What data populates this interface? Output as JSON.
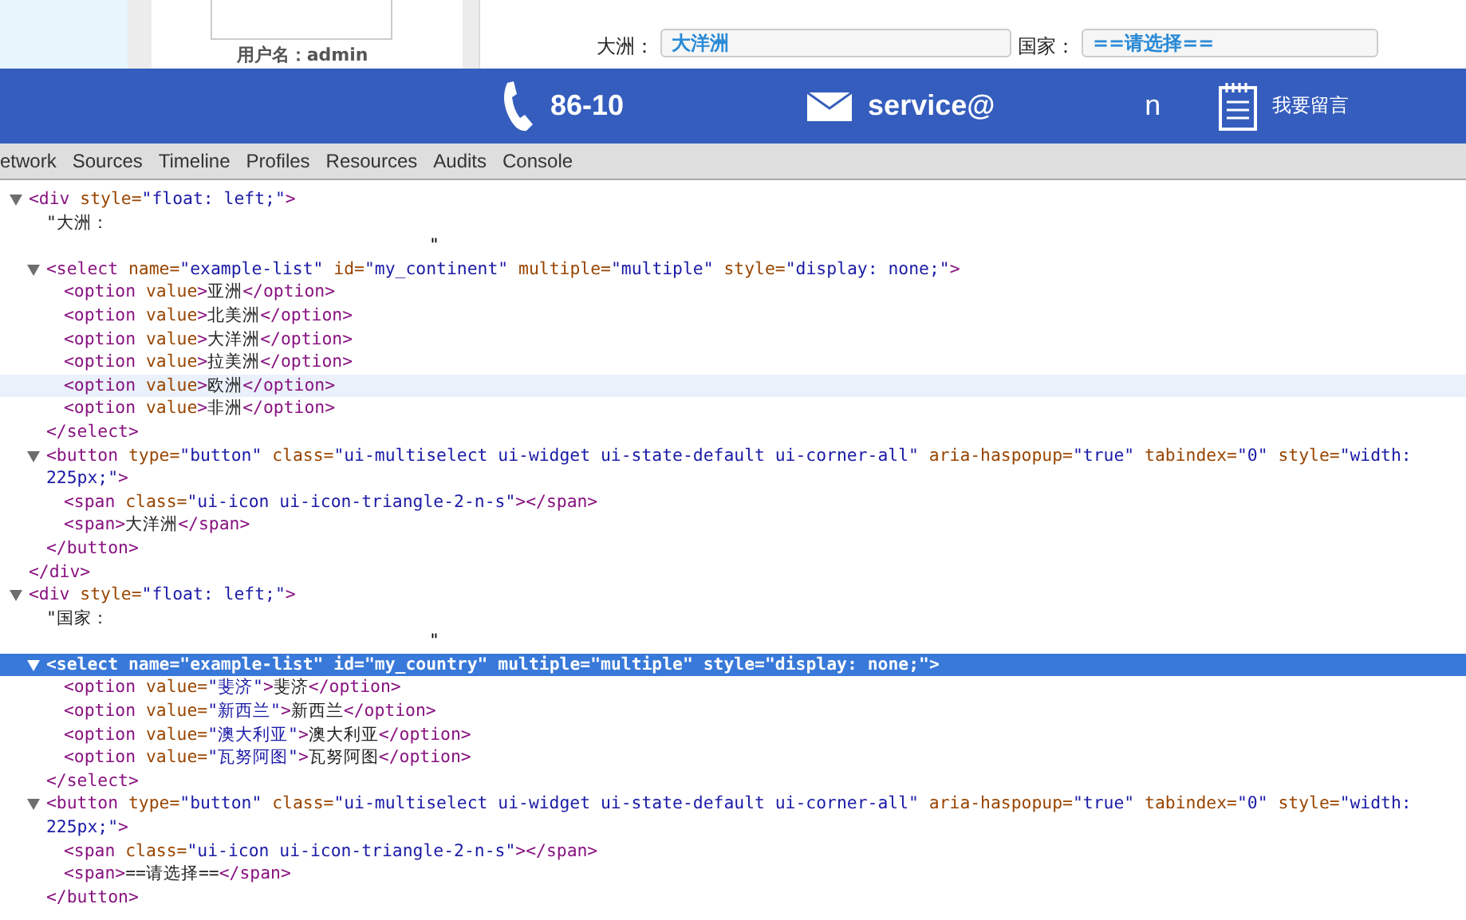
{
  "page": {
    "username": "用户名：admin",
    "continent_label": "大洲：",
    "continent_value": "大洋洲",
    "country_label": "国家：",
    "country_value": "==请选择=="
  },
  "banner": {
    "phone": "86-10",
    "email": "service@",
    "fragment": "n",
    "message": "我要留言"
  },
  "devtools_tabs": [
    {
      "label": "etwork",
      "selected": false
    },
    {
      "label": "Sources",
      "selected": false
    },
    {
      "label": "Timeline",
      "selected": false
    },
    {
      "label": "Profiles",
      "selected": false
    },
    {
      "label": "Resources",
      "selected": false
    },
    {
      "label": "Audits",
      "selected": false
    },
    {
      "label": "Console",
      "selected": false
    }
  ],
  "code": [
    {
      "kind": "element",
      "expanded": true,
      "selected": false,
      "hovered": false,
      "open": [
        {
          "kind": "tag",
          "text": "<div"
        },
        {
          "kind": "attr",
          "text": " style="
        },
        {
          "kind": "value",
          "text": "\"float: left;\""
        },
        {
          "kind": "tag",
          "text": ">"
        }
      ],
      "close": [
        {
          "kind": "tag",
          "text": "</div>"
        }
      ],
      "children": [
        {
          "kind": "text",
          "selected": false,
          "hovered": false,
          "text": "\"大洲：",
          "tail": "\""
        },
        {
          "kind": "element",
          "expanded": true,
          "selected": false,
          "hovered": false,
          "open": [
            {
              "kind": "tag",
              "text": "<select"
            },
            {
              "kind": "attr",
              "text": " name="
            },
            {
              "kind": "value",
              "text": "\"example-list\""
            },
            {
              "kind": "attr",
              "text": " id="
            },
            {
              "kind": "value",
              "text": "\"my_continent\""
            },
            {
              "kind": "attr",
              "text": " multiple="
            },
            {
              "kind": "value",
              "text": "\"multiple\""
            },
            {
              "kind": "attr",
              "text": " style="
            },
            {
              "kind": "value",
              "text": "\"display: none;\""
            },
            {
              "kind": "tag",
              "text": ">"
            }
          ],
          "close": [
            {
              "kind": "tag",
              "text": "</select>"
            }
          ],
          "children": [
            {
              "kind": "element",
              "selected": false,
              "hovered": false,
              "open": [
                {
                  "kind": "tag",
                  "text": "<option"
                },
                {
                  "kind": "attr",
                  "text": " value"
                },
                {
                  "kind": "tag",
                  "text": ">"
                },
                {
                  "kind": "text",
                  "text": "亚洲"
                },
                {
                  "kind": "tag",
                  "text": "</option>"
                }
              ]
            },
            {
              "kind": "element",
              "selected": false,
              "hovered": false,
              "open": [
                {
                  "kind": "tag",
                  "text": "<option"
                },
                {
                  "kind": "attr",
                  "text": " value"
                },
                {
                  "kind": "tag",
                  "text": ">"
                },
                {
                  "kind": "text",
                  "text": "北美洲"
                },
                {
                  "kind": "tag",
                  "text": "</option>"
                }
              ]
            },
            {
              "kind": "element",
              "selected": false,
              "hovered": false,
              "open": [
                {
                  "kind": "tag",
                  "text": "<option"
                },
                {
                  "kind": "attr",
                  "text": " value"
                },
                {
                  "kind": "tag",
                  "text": ">"
                },
                {
                  "kind": "text",
                  "text": "大洋洲"
                },
                {
                  "kind": "tag",
                  "text": "</option>"
                }
              ]
            },
            {
              "kind": "element",
              "selected": false,
              "hovered": false,
              "open": [
                {
                  "kind": "tag",
                  "text": "<option"
                },
                {
                  "kind": "attr",
                  "text": " value"
                },
                {
                  "kind": "tag",
                  "text": ">"
                },
                {
                  "kind": "text",
                  "text": "拉美洲"
                },
                {
                  "kind": "tag",
                  "text": "</option>"
                }
              ]
            },
            {
              "kind": "element",
              "selected": false,
              "hovered": true,
              "open": [
                {
                  "kind": "tag",
                  "text": "<option"
                },
                {
                  "kind": "attr",
                  "text": " value"
                },
                {
                  "kind": "tag",
                  "text": ">"
                },
                {
                  "kind": "text",
                  "text": "欧洲"
                },
                {
                  "kind": "tag",
                  "text": "</option>"
                }
              ]
            },
            {
              "kind": "element",
              "selected": false,
              "hovered": false,
              "open": [
                {
                  "kind": "tag",
                  "text": "<option"
                },
                {
                  "kind": "attr",
                  "text": " value"
                },
                {
                  "kind": "tag",
                  "text": ">"
                },
                {
                  "kind": "text",
                  "text": "非洲"
                },
                {
                  "kind": "tag",
                  "text": "</option>"
                }
              ]
            }
          ]
        },
        {
          "kind": "element",
          "expanded": true,
          "selected": false,
          "hovered": false,
          "open": [
            {
              "kind": "tag",
              "text": "<button"
            },
            {
              "kind": "attr",
              "text": " type="
            },
            {
              "kind": "value",
              "text": "\"button\""
            },
            {
              "kind": "attr",
              "text": " class="
            },
            {
              "kind": "value",
              "text": "\"ui-multiselect ui-widget ui-state-default ui-corner-all\""
            },
            {
              "kind": "attr",
              "text": " aria-haspopup="
            },
            {
              "kind": "value",
              "text": "\"true\""
            },
            {
              "kind": "attr",
              "text": " tabindex="
            },
            {
              "kind": "value",
              "text": "\"0\""
            },
            {
              "kind": "attr",
              "text": " style="
            },
            {
              "kind": "value",
              "text": "\"width: 225px;\""
            },
            {
              "kind": "tag",
              "text": ">"
            }
          ],
          "close": [
            {
              "kind": "tag",
              "text": "</button>"
            }
          ],
          "children": [
            {
              "kind": "element",
              "selected": false,
              "hovered": false,
              "open": [
                {
                  "kind": "tag",
                  "text": "<span"
                },
                {
                  "kind": "attr",
                  "text": " class="
                },
                {
                  "kind": "value",
                  "text": "\"ui-icon ui-icon-triangle-2-n-s\""
                },
                {
                  "kind": "tag",
                  "text": "></span>"
                }
              ]
            },
            {
              "kind": "element",
              "selected": false,
              "hovered": false,
              "open": [
                {
                  "kind": "tag",
                  "text": "<span>"
                },
                {
                  "kind": "text",
                  "text": "大洋洲"
                },
                {
                  "kind": "tag",
                  "text": "</span>"
                }
              ]
            }
          ]
        }
      ]
    },
    {
      "kind": "element",
      "expanded": true,
      "selected": false,
      "hovered": false,
      "open": [
        {
          "kind": "tag",
          "text": "<div"
        },
        {
          "kind": "attr",
          "text": " style="
        },
        {
          "kind": "value",
          "text": "\"float: left;\""
        },
        {
          "kind": "tag",
          "text": ">"
        }
      ],
      "children": [
        {
          "kind": "text",
          "selected": false,
          "hovered": false,
          "text": "\"国家：",
          "tail": "\""
        },
        {
          "kind": "element",
          "expanded": true,
          "selected": true,
          "hovered": false,
          "open": [
            {
              "kind": "tag",
              "text": "<select"
            },
            {
              "kind": "attr",
              "text": " name="
            },
            {
              "kind": "value",
              "text": "\"example-list\""
            },
            {
              "kind": "attr",
              "text": " id="
            },
            {
              "kind": "value",
              "text": "\"my_country\""
            },
            {
              "kind": "attr",
              "text": " multiple="
            },
            {
              "kind": "value",
              "text": "\"multiple\""
            },
            {
              "kind": "attr",
              "text": " style="
            },
            {
              "kind": "value",
              "text": "\"display: none;\""
            },
            {
              "kind": "tag",
              "text": ">"
            }
          ],
          "close": [
            {
              "kind": "tag",
              "text": "</select>"
            }
          ],
          "children": [
            {
              "kind": "element",
              "selected": false,
              "hovered": false,
              "open": [
                {
                  "kind": "tag",
                  "text": "<option"
                },
                {
                  "kind": "attr",
                  "text": " value="
                },
                {
                  "kind": "value",
                  "text": "\"斐济\""
                },
                {
                  "kind": "tag",
                  "text": ">"
                },
                {
                  "kind": "text",
                  "text": "斐济"
                },
                {
                  "kind": "tag",
                  "text": "</option>"
                }
              ]
            },
            {
              "kind": "element",
              "selected": false,
              "hovered": false,
              "open": [
                {
                  "kind": "tag",
                  "text": "<option"
                },
                {
                  "kind": "attr",
                  "text": " value="
                },
                {
                  "kind": "value",
                  "text": "\"新西兰\""
                },
                {
                  "kind": "tag",
                  "text": ">"
                },
                {
                  "kind": "text",
                  "text": "新西兰"
                },
                {
                  "kind": "tag",
                  "text": "</option>"
                }
              ]
            },
            {
              "kind": "element",
              "selected": false,
              "hovered": false,
              "open": [
                {
                  "kind": "tag",
                  "text": "<option"
                },
                {
                  "kind": "attr",
                  "text": " value="
                },
                {
                  "kind": "value",
                  "text": "\"澳大利亚\""
                },
                {
                  "kind": "tag",
                  "text": ">"
                },
                {
                  "kind": "text",
                  "text": "澳大利亚"
                },
                {
                  "kind": "tag",
                  "text": "</option>"
                }
              ]
            },
            {
              "kind": "element",
              "selected": false,
              "hovered": false,
              "open": [
                {
                  "kind": "tag",
                  "text": "<option"
                },
                {
                  "kind": "attr",
                  "text": " value="
                },
                {
                  "kind": "value",
                  "text": "\"瓦努阿图\""
                },
                {
                  "kind": "tag",
                  "text": ">"
                },
                {
                  "kind": "text",
                  "text": "瓦努阿图"
                },
                {
                  "kind": "tag",
                  "text": "</option>"
                }
              ]
            }
          ]
        },
        {
          "kind": "element",
          "expanded": true,
          "selected": false,
          "hovered": false,
          "open": [
            {
              "kind": "tag",
              "text": "<button"
            },
            {
              "kind": "attr",
              "text": " type="
            },
            {
              "kind": "value",
              "text": "\"button\""
            },
            {
              "kind": "attr",
              "text": " class="
            },
            {
              "kind": "value",
              "text": "\"ui-multiselect ui-widget ui-state-default ui-corner-all\""
            },
            {
              "kind": "attr",
              "text": " aria-haspopup="
            },
            {
              "kind": "value",
              "text": "\"true\""
            },
            {
              "kind": "attr",
              "text": " tabindex="
            },
            {
              "kind": "value",
              "text": "\"0\""
            },
            {
              "kind": "attr",
              "text": " style="
            },
            {
              "kind": "value",
              "text": "\"width: 225px;\""
            },
            {
              "kind": "tag",
              "text": ">"
            }
          ],
          "close": [
            {
              "kind": "tag",
              "text": "</button>"
            }
          ],
          "children": [
            {
              "kind": "element",
              "selected": false,
              "hovered": false,
              "open": [
                {
                  "kind": "tag",
                  "text": "<span"
                },
                {
                  "kind": "attr",
                  "text": " class="
                },
                {
                  "kind": "value",
                  "text": "\"ui-icon ui-icon-triangle-2-n-s\""
                },
                {
                  "kind": "tag",
                  "text": "></span>"
                }
              ]
            },
            {
              "kind": "element",
              "selected": false,
              "hovered": false,
              "open": [
                {
                  "kind": "tag",
                  "text": "<span>"
                },
                {
                  "kind": "text",
                  "text": "==请选择=="
                },
                {
                  "kind": "tag",
                  "text": "</span>"
                }
              ]
            }
          ]
        }
      ]
    }
  ]
}
